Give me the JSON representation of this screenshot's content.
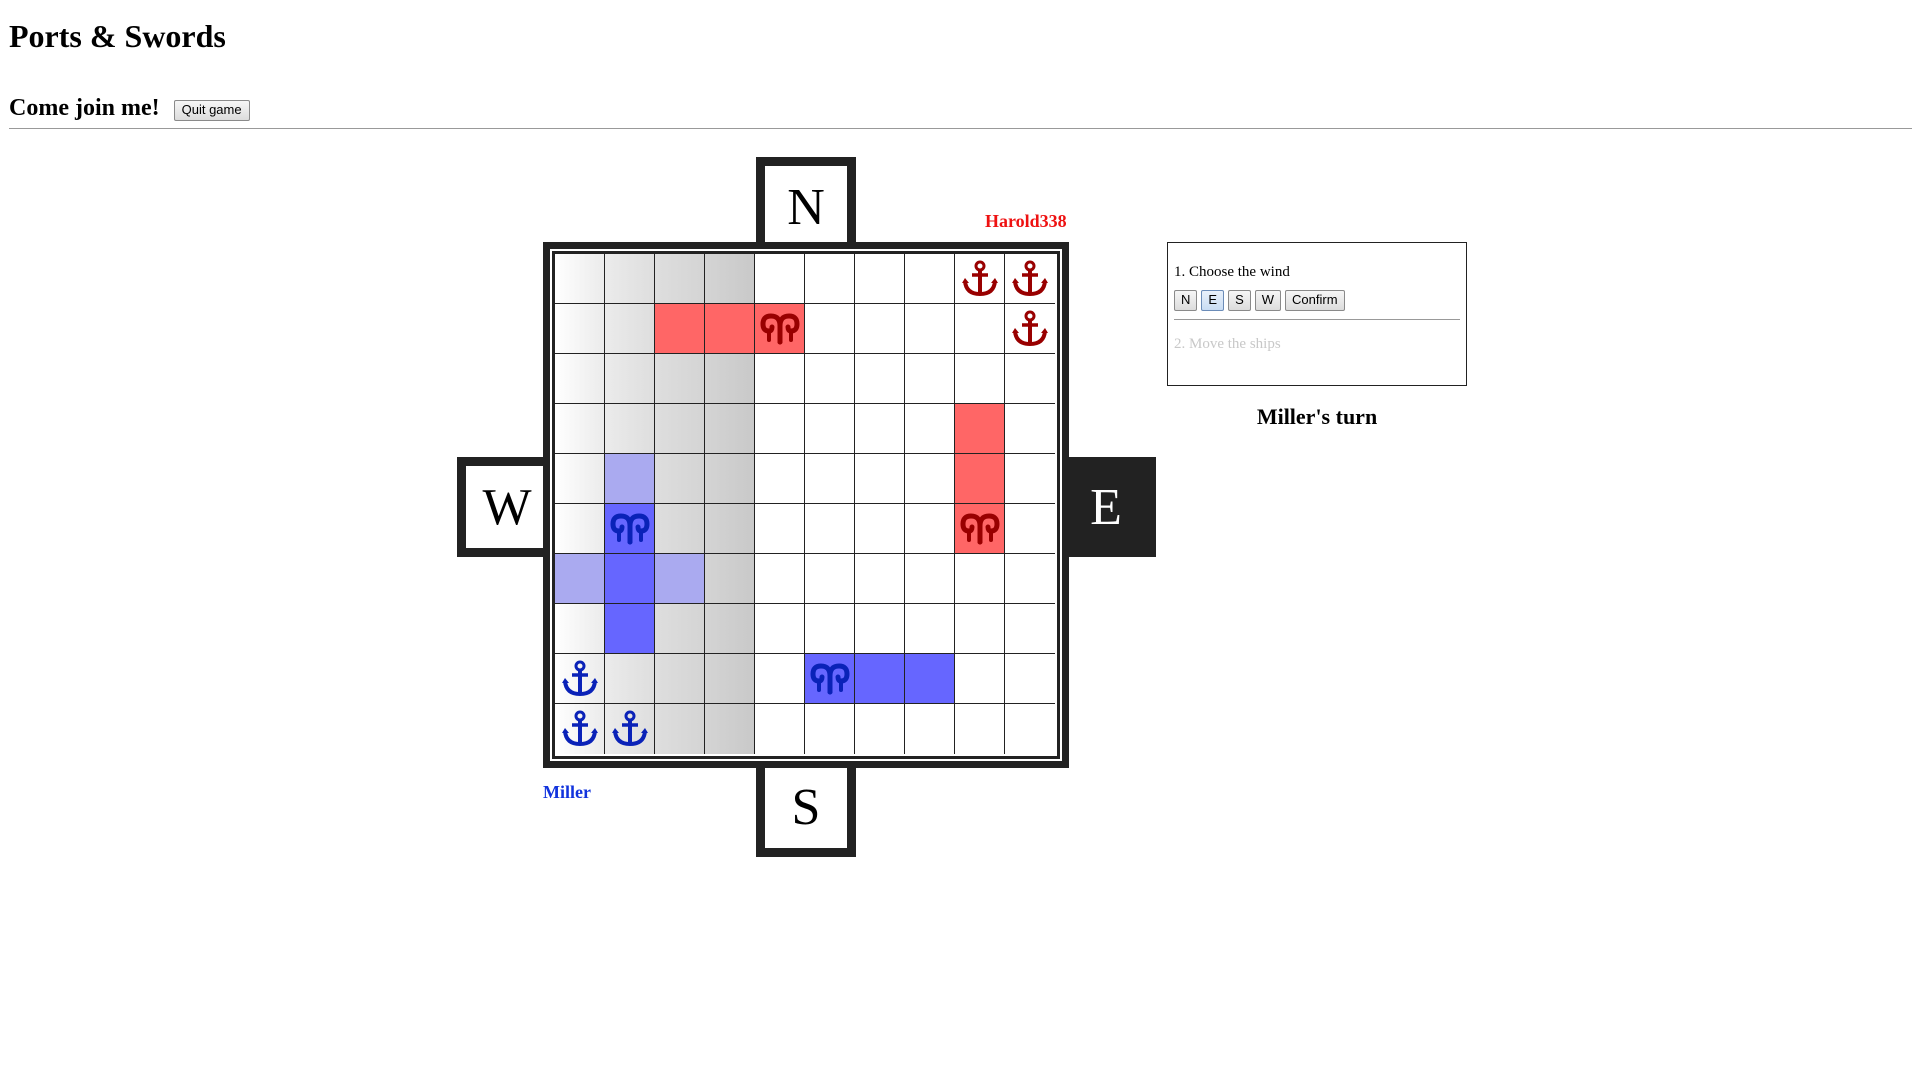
{
  "header": {
    "title": "Ports & Swords",
    "subtitle": "Come join me!",
    "quit_label": "Quit game"
  },
  "compass": {
    "north": "N",
    "east": "E",
    "south": "S",
    "west": "W",
    "active": "E"
  },
  "players": {
    "red": {
      "name": "Harold338",
      "color": "#ee1111"
    },
    "blue": {
      "name": "Miller",
      "color": "#1133dd"
    }
  },
  "board": {
    "size": 10,
    "shaded_columns": [
      0,
      1,
      2,
      3
    ],
    "red_cells": [
      [
        1,
        2
      ],
      [
        1,
        3
      ],
      [
        1,
        4
      ],
      [
        3,
        8
      ],
      [
        4,
        8
      ],
      [
        5,
        8
      ]
    ],
    "blue_cells": [
      [
        5,
        1
      ],
      [
        6,
        1
      ],
      [
        7,
        1
      ],
      [
        8,
        5
      ],
      [
        8,
        6
      ],
      [
        8,
        7
      ]
    ],
    "light_blue_cells": [
      [
        4,
        1
      ],
      [
        6,
        0
      ],
      [
        6,
        2
      ]
    ],
    "red_ship_heads": [
      [
        1,
        4
      ],
      [
        5,
        8
      ]
    ],
    "blue_ship_heads": [
      [
        5,
        1
      ],
      [
        8,
        5
      ]
    ],
    "red_ports": [
      [
        0,
        8
      ],
      [
        0,
        9
      ],
      [
        1,
        9
      ]
    ],
    "blue_ports": [
      [
        8,
        0
      ],
      [
        9,
        0
      ],
      [
        9,
        1
      ]
    ],
    "colors": {
      "red_ship": "#ff6666",
      "blue_ship": "#6666ff",
      "blue_move": "#aaaaf0",
      "red_icon": "#990000",
      "blue_icon": "#0a22b8"
    }
  },
  "panel": {
    "step1_label": "1. Choose the wind",
    "wind_options": [
      "N",
      "E",
      "S",
      "W"
    ],
    "selected_wind": "E",
    "confirm_label": "Confirm",
    "step2_label": "2. Move the ships"
  },
  "status": {
    "turn_text": "Miller's turn"
  }
}
